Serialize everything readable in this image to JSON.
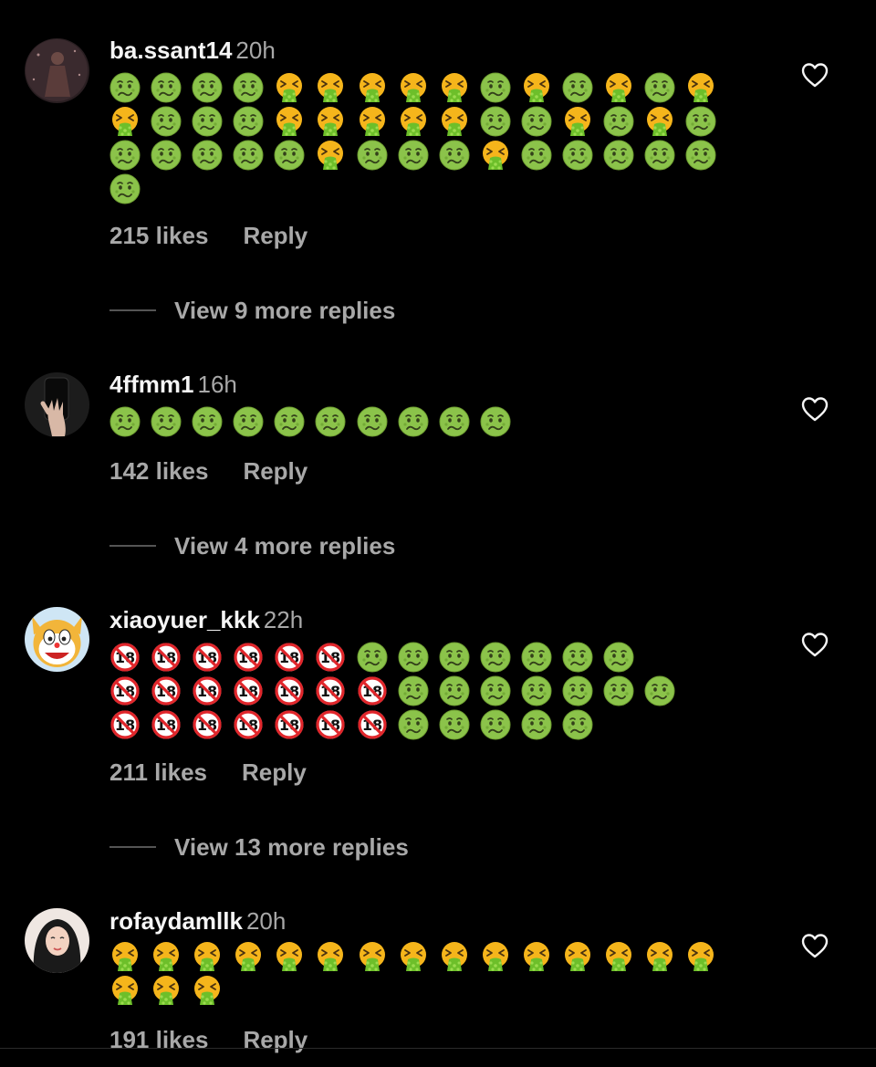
{
  "comments": [
    {
      "username": "ba.ssant14",
      "time": "20h",
      "likes": "215 likes",
      "reply": "Reply",
      "view_more": "View 9 more replies",
      "avatar_icon": "avatar-dark-figure",
      "emoji_rows": [
        [
          "nauseated",
          "nauseated",
          "nauseated",
          "nauseated",
          "vomiting",
          "vomiting",
          "vomiting",
          "vomiting",
          "vomiting",
          "nauseated",
          "vomiting",
          "nauseated",
          "vomiting",
          "nauseated",
          "vomiting"
        ],
        [
          "vomiting",
          "nauseated",
          "nauseated",
          "nauseated",
          "vomiting",
          "vomiting",
          "vomiting",
          "vomiting",
          "vomiting",
          "nauseated",
          "nauseated",
          "vomiting",
          "nauseated",
          "vomiting",
          "nauseated"
        ],
        [
          "nauseated",
          "nauseated",
          "nauseated",
          "nauseated",
          "nauseated",
          "vomiting",
          "nauseated",
          "nauseated",
          "nauseated",
          "vomiting",
          "nauseated",
          "nauseated",
          "nauseated",
          "nauseated",
          "nauseated"
        ],
        [
          "nauseated"
        ]
      ]
    },
    {
      "username": "4ffmm1",
      "time": "16h",
      "likes": "142 likes",
      "reply": "Reply",
      "view_more": "View 4 more replies",
      "avatar_icon": "avatar-hand-selfie",
      "emoji_rows": [
        [
          "nauseated",
          "nauseated",
          "nauseated",
          "nauseated",
          "nauseated",
          "nauseated",
          "nauseated",
          "nauseated",
          "nauseated",
          "nauseated"
        ]
      ]
    },
    {
      "username": "xiaoyuer_kkk",
      "time": "22h",
      "likes": "211 likes",
      "reply": "Reply",
      "view_more": "View 13 more replies",
      "avatar_icon": "avatar-cartoon-cat",
      "emoji_rows": [
        [
          "no-under-18",
          "no-under-18",
          "no-under-18",
          "no-under-18",
          "no-under-18",
          "no-under-18",
          "nauseated",
          "nauseated",
          "nauseated",
          "nauseated",
          "nauseated",
          "nauseated",
          "nauseated"
        ],
        [
          "no-under-18",
          "no-under-18",
          "no-under-18",
          "no-under-18",
          "no-under-18",
          "no-under-18",
          "no-under-18",
          "nauseated",
          "nauseated",
          "nauseated",
          "nauseated",
          "nauseated",
          "nauseated",
          "nauseated"
        ],
        [
          "no-under-18",
          "no-under-18",
          "no-under-18",
          "no-under-18",
          "no-under-18",
          "no-under-18",
          "no-under-18",
          "nauseated",
          "nauseated",
          "nauseated",
          "nauseated",
          "nauseated"
        ]
      ]
    },
    {
      "username": "rofaydamllk",
      "time": "20h",
      "likes": "191 likes",
      "reply": "Reply",
      "view_more": "",
      "avatar_icon": "avatar-hijab-illustration",
      "emoji_rows": [
        [
          "vomiting",
          "vomiting",
          "vomiting",
          "vomiting",
          "vomiting",
          "vomiting",
          "vomiting",
          "vomiting",
          "vomiting",
          "vomiting",
          "vomiting",
          "vomiting",
          "vomiting",
          "vomiting",
          "vomiting"
        ],
        [
          "vomiting",
          "vomiting",
          "vomiting"
        ]
      ]
    }
  ],
  "colors": {
    "background": "#000000",
    "text_primary": "#f5f5f5",
    "text_secondary": "#a8a8a8",
    "nauseated_face": "#8bc34a",
    "vomiting_face": "#f5b51b",
    "vomit": "#6dbf2a",
    "prohibited_red": "#e0262b"
  }
}
